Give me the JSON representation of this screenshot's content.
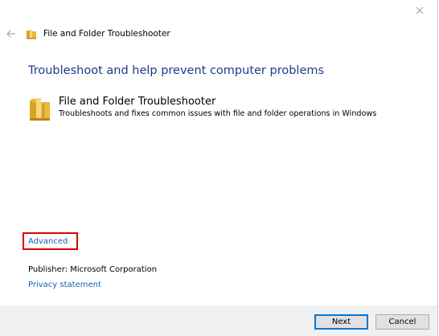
{
  "window": {
    "title": "File and Folder Troubleshooter"
  },
  "main": {
    "heading": "Troubleshoot and help prevent computer problems",
    "item": {
      "title": "File and Folder Troubleshooter",
      "description": "Troubleshoots and fixes common issues with file and folder operations in Windows"
    },
    "advanced_link": "Advanced",
    "publisher": "Publisher:  Microsoft Corporation",
    "privacy_link": "Privacy statement"
  },
  "footer": {
    "next_label": "Next",
    "cancel_label": "Cancel"
  },
  "icons": {
    "back": "back-arrow-icon",
    "close": "close-icon",
    "folder": "folder-icon"
  },
  "colors": {
    "heading": "#1e3a8a",
    "link": "#1a5fb4",
    "highlight": "#e00000",
    "footer_bg": "#f0f0f0"
  }
}
